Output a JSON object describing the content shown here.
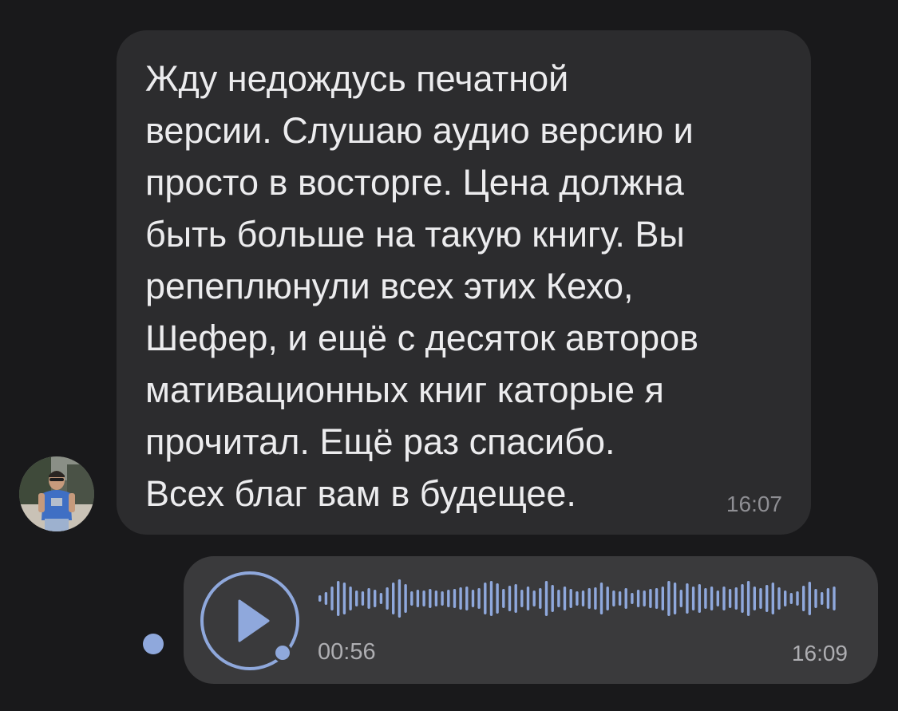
{
  "incoming_message": {
    "text": "Жду недождусь печатной\nверсии. Слушаю аудио версию и\nпросто в восторге. Цена должна\nбыть больше на такую книгу. Вы\npепеплюнули всех этих Кехо,\nШефер, и ещё с десяток авторов\nмативационных книг каторые я\nпрочитал. Ещё раз спасибо.\nВсех благ вам в будещее.",
    "time": "16:07"
  },
  "voice_message": {
    "duration": "00:56",
    "time": "16:09",
    "played_fraction": 0
  },
  "colors": {
    "background": "#19191b",
    "incoming_bubble": "#2c2c2e",
    "outgoing_bubble": "#3a3a3c",
    "accent": "#8fa8dc",
    "text": "#ececee",
    "secondary_text": "#8e8e93"
  }
}
